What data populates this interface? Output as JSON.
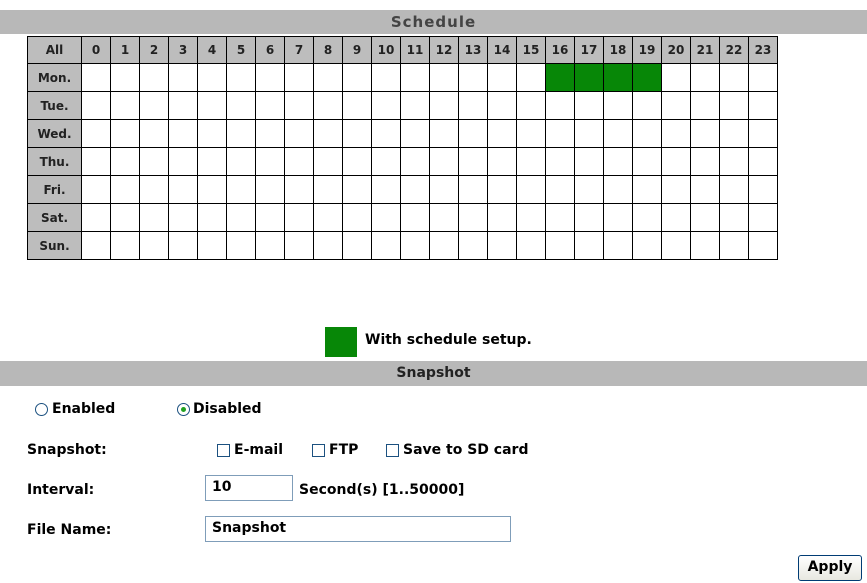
{
  "schedule": {
    "title": "Schedule",
    "all_label": "All",
    "hours": [
      "0",
      "1",
      "2",
      "3",
      "4",
      "5",
      "6",
      "7",
      "8",
      "9",
      "10",
      "11",
      "12",
      "13",
      "14",
      "15",
      "16",
      "17",
      "18",
      "19",
      "20",
      "21",
      "22",
      "23"
    ],
    "days": [
      {
        "label": "Mon.",
        "active_hours": [
          16,
          17,
          18,
          19
        ]
      },
      {
        "label": "Tue.",
        "active_hours": []
      },
      {
        "label": "Wed.",
        "active_hours": []
      },
      {
        "label": "Thu.",
        "active_hours": []
      },
      {
        "label": "Fri.",
        "active_hours": []
      },
      {
        "label": "Sat.",
        "active_hours": []
      },
      {
        "label": "Sun.",
        "active_hours": []
      }
    ],
    "active_color": "#078707",
    "legend_text": "With schedule setup."
  },
  "snapshot": {
    "title": "Snapshot",
    "enabled_label": "Enabled",
    "disabled_label": "Disabled",
    "mode_selected": "Disabled",
    "snapshot_label": "Snapshot:",
    "email_label": "E-mail",
    "ftp_label": "FTP",
    "sd_label": "Save to SD card",
    "email_checked": false,
    "ftp_checked": false,
    "sd_checked": false,
    "interval_label": "Interval:",
    "interval_value": "10",
    "interval_unit": "Second(s) [1..50000]",
    "filename_label": "File Name:",
    "filename_value": "Snapshot"
  },
  "apply_label": "Apply"
}
